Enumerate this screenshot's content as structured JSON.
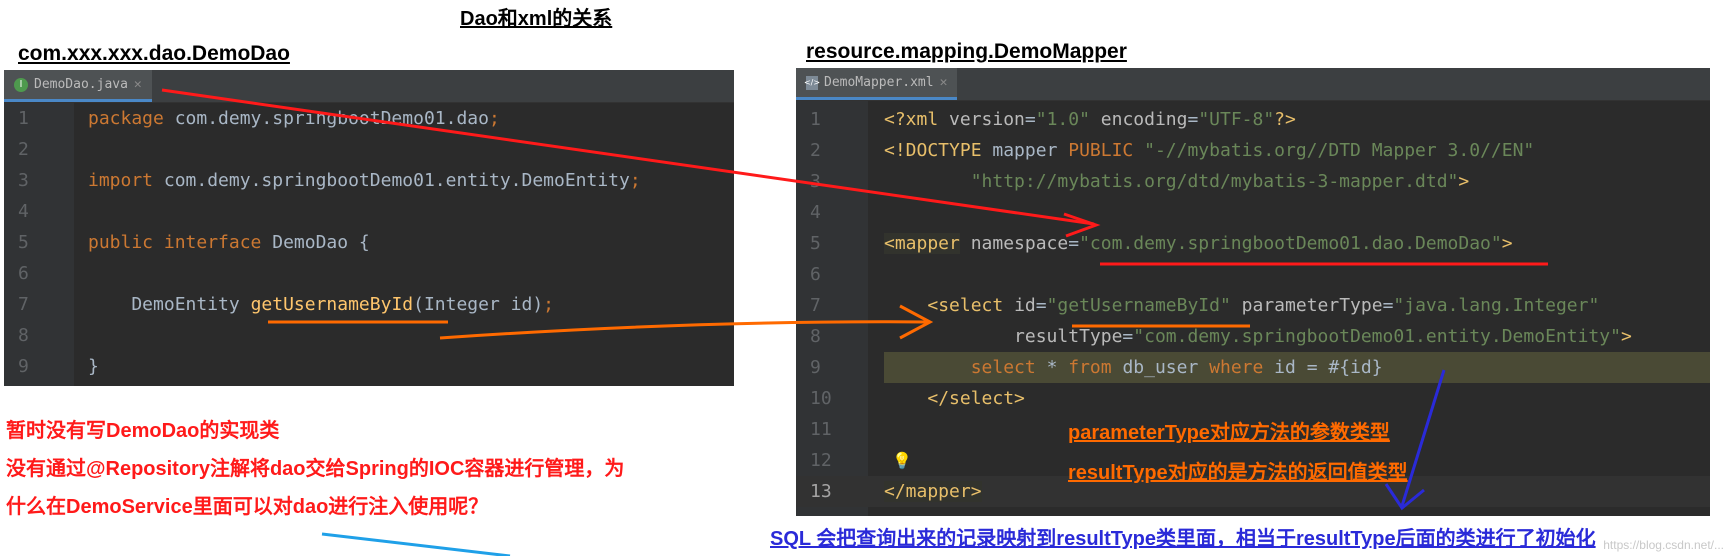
{
  "page_title": "Dao和xml的关系",
  "left_path": "com.xxx.xxx.dao.DemoDao",
  "right_path": "resource.mapping.DemoMapper",
  "left_editor": {
    "tab_label": "DemoDao.java",
    "tab_icon": "java-interface-icon",
    "line_numbers": [
      "1",
      "2",
      "3",
      "4",
      "5",
      "6",
      "7",
      "8",
      "9"
    ]
  },
  "right_editor": {
    "tab_label": "DemoMapper.xml",
    "tab_icon": "xml-file-icon",
    "line_numbers": [
      "1",
      "2",
      "3",
      "4",
      "5",
      "6",
      "7",
      "8",
      "9",
      "10",
      "11",
      "12",
      "13"
    ]
  },
  "annotations": {
    "red_line1": "暂时没有写DemoDao的实现类",
    "red_line2": "没有通过@Repository注解将dao交给Spring的IOC容器进行管理，为",
    "red_line3": "什么在DemoService里面可以对dao进行注入使用呢？",
    "orange_line1": "parameterType对应方法的参数类型",
    "orange_line2": "resultType对应的是方法的返回值类型",
    "blue_line": "SQL  会把查询出来的记录映射到resultType类里面，相当于resultType后面的类进行了初始化"
  },
  "watermark": "https://blog.csdn.net/...",
  "colors": {
    "editor_bg": "#2b2b2b",
    "keyword": "#cc7832",
    "string": "#6a8759",
    "xml_tag": "#e8bf6a",
    "function": "#ffc66d",
    "annotation_red": "#ff1a1a",
    "annotation_orange": "#ff6a00",
    "annotation_blue": "#2a2ad8"
  }
}
